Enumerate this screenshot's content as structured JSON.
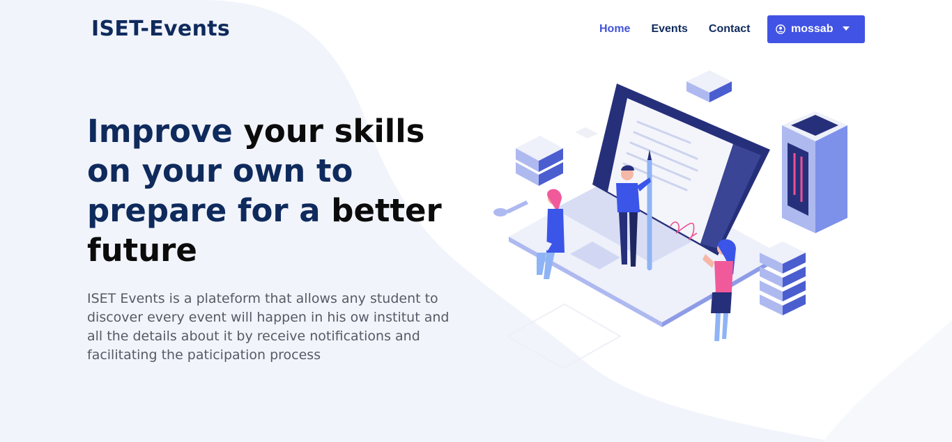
{
  "brand": {
    "name": "ISET-Events"
  },
  "nav": {
    "items": [
      {
        "label": "Home",
        "active": true
      },
      {
        "label": "Events",
        "active": false
      },
      {
        "label": "Contact",
        "active": false
      }
    ],
    "user": {
      "name": "mossab",
      "icon": "user-circle-icon"
    }
  },
  "hero": {
    "title_parts": [
      "Improve ",
      "your skills",
      " on your own to prepare for a ",
      "better future"
    ],
    "description": "ISET Events is a plateform that allows any student to discover every event will happen in his ow institut and all the details about it by receive notifications and facilitating the paticipation process"
  },
  "colors": {
    "primary": "#4153e4",
    "navy": "#0f2a5c",
    "background_wave": "#f1f4fb",
    "text": "#555a66"
  },
  "illustration": {
    "icon": "laptop-signature-illustration"
  }
}
